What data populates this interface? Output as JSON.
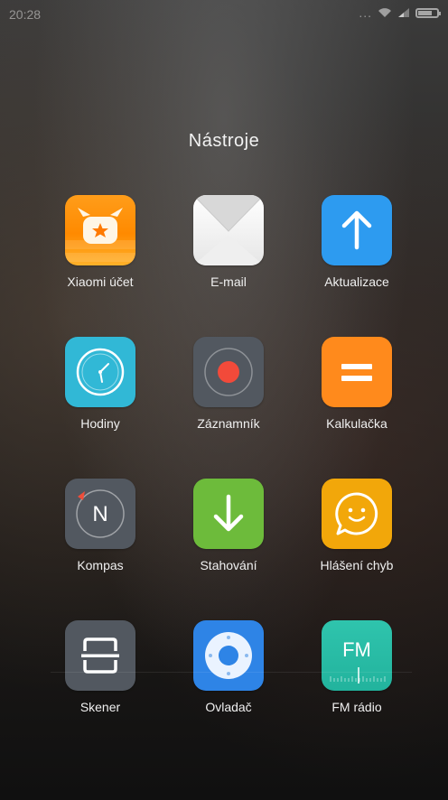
{
  "status": {
    "time": "20:28",
    "dots": "...",
    "icons": [
      "wifi-icon",
      "signal-icon",
      "battery-icon"
    ]
  },
  "folder": {
    "title": "Nástroje"
  },
  "apps": [
    {
      "label": "Xiaomi účet",
      "icon": "xiaomi-account-icon",
      "color": "#ff9d1a"
    },
    {
      "label": "E-mail",
      "icon": "email-icon",
      "color": "#f2f2f2"
    },
    {
      "label": "Aktualizace",
      "icon": "update-icon",
      "color": "#2d9bf0"
    },
    {
      "label": "Hodiny",
      "icon": "clock-icon",
      "color": "#31b8d6"
    },
    {
      "label": "Záznamník",
      "icon": "recorder-icon",
      "color": "#525860"
    },
    {
      "label": "Kalkulačka",
      "icon": "calculator-icon",
      "color": "#ff8a1c"
    },
    {
      "label": "Kompas",
      "icon": "compass-icon",
      "color": "#525860"
    },
    {
      "label": "Stahování",
      "icon": "download-icon",
      "color": "#6dbb3b"
    },
    {
      "label": "Hlášení chyb",
      "icon": "bug-report-icon",
      "color": "#f2a70a"
    },
    {
      "label": "Skener",
      "icon": "scanner-icon",
      "color": "#525860"
    },
    {
      "label": "Ovladač",
      "icon": "remote-icon",
      "color": "#2e84e6"
    },
    {
      "label": "FM rádio",
      "icon": "fm-radio-icon",
      "color": "#2fc4ad",
      "icon_text": "FM"
    }
  ],
  "compass_letter": "N"
}
